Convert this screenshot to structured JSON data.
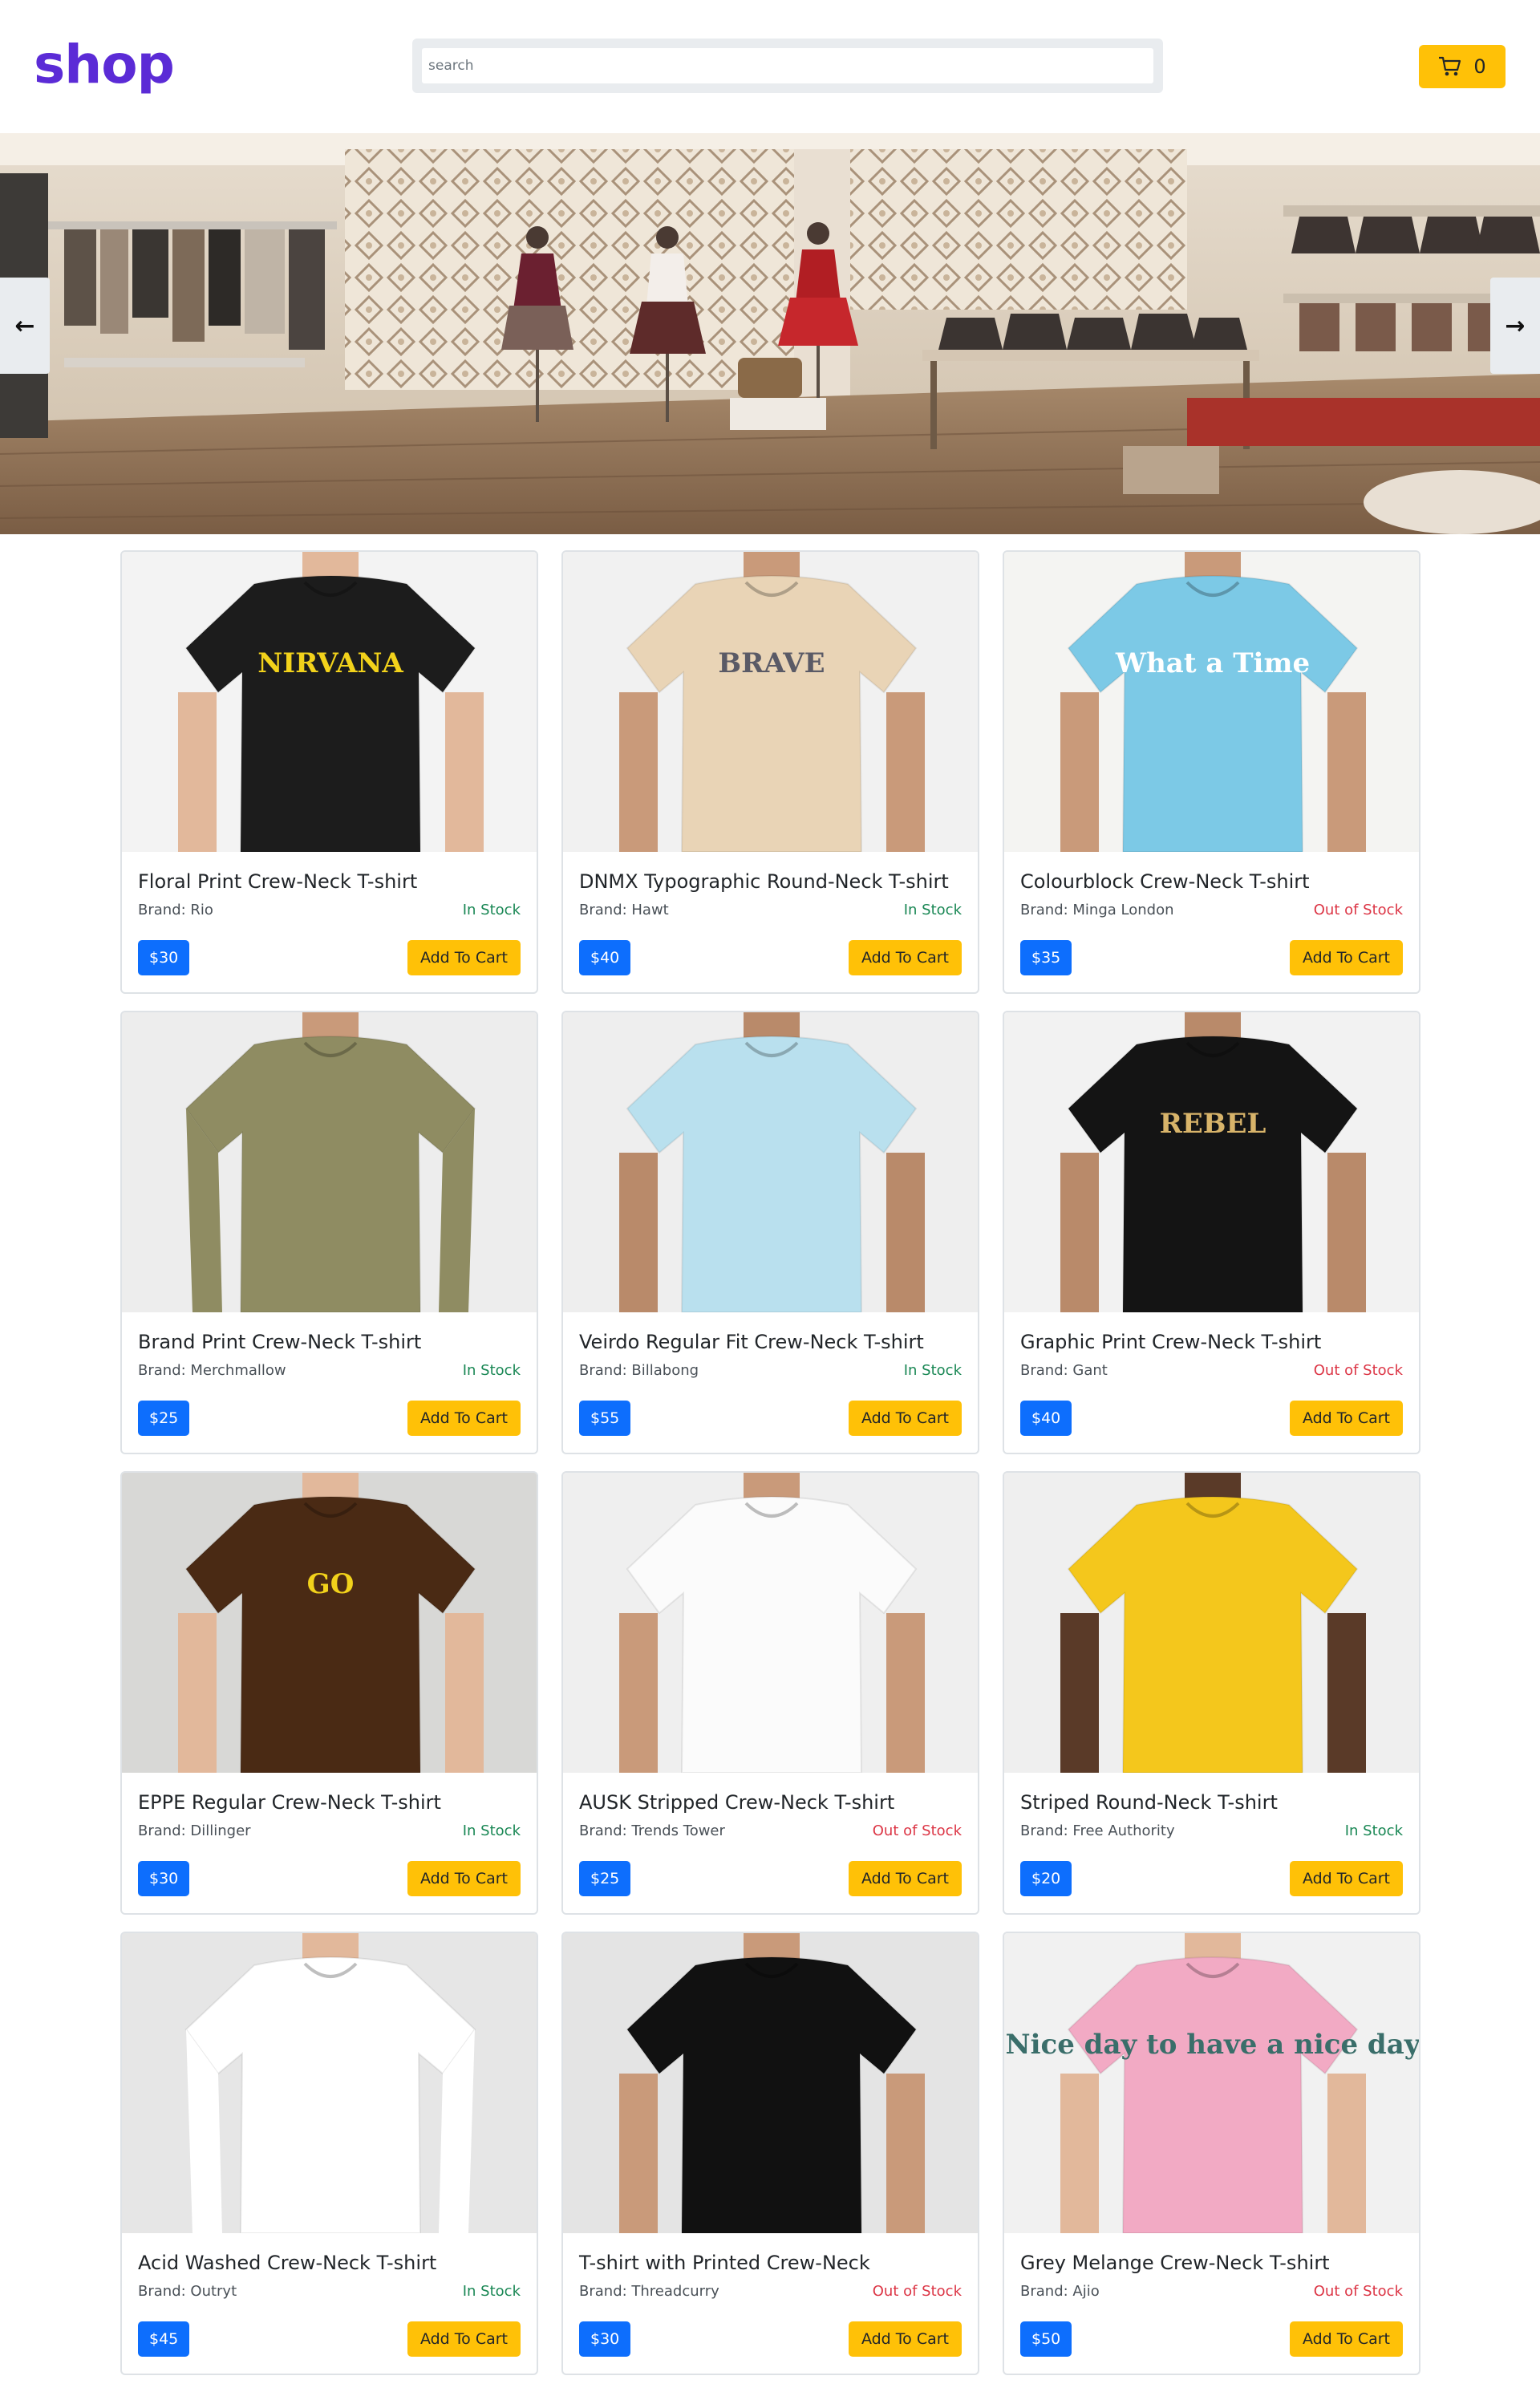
{
  "header": {
    "logo": "shop",
    "search_placeholder": "search",
    "cart_count": "0"
  },
  "carousel": {
    "prev_icon": "arrow-left-icon",
    "next_icon": "arrow-right-icon"
  },
  "products": [
    {
      "title": "Floral Print Crew-Neck T-shirt",
      "brand": "Brand: Rio",
      "stock": "In Stock",
      "in_stock": true,
      "price": "$30",
      "cta": "Add To Cart",
      "shirt": "#1c1c1c",
      "print": "NIRVANA",
      "print_color": "#f2d21b",
      "bg": "#f3f3f3",
      "skin": "#e2b89b"
    },
    {
      "title": "DNMX Typographic Round-Neck T-shirt",
      "brand": "Brand: Hawt",
      "stock": "In Stock",
      "in_stock": true,
      "price": "$40",
      "cta": "Add To Cart",
      "shirt": "#e9d4b6",
      "print": "BRAVE",
      "print_color": "#5a5a66",
      "bg": "#f1f1f1",
      "skin": "#c99a7a"
    },
    {
      "title": "Colourblock Crew-Neck T-shirt",
      "brand": "Brand: Minga London",
      "stock": "Out of Stock",
      "in_stock": false,
      "price": "$35",
      "cta": "Add To Cart",
      "shirt": "#7cc9e6",
      "print": "What a Time",
      "print_color": "#ffffff",
      "bg": "#f4f4f2",
      "skin": "#c99a7a"
    },
    {
      "title": "Brand Print Crew-Neck T-shirt",
      "brand": "Brand: Merchmallow",
      "stock": "In Stock",
      "in_stock": true,
      "price": "$25",
      "cta": "Add To Cart",
      "shirt": "#8f8c62",
      "print": "",
      "print_color": "#ffffff",
      "bg": "#ededed",
      "skin": "#c99a7a"
    },
    {
      "title": "Veirdo Regular Fit Crew-Neck T-shirt",
      "brand": "Brand: Billabong",
      "stock": "In Stock",
      "in_stock": true,
      "price": "$55",
      "cta": "Add To Cart",
      "shirt": "#b9e0ee",
      "print": "",
      "print_color": "#ffffff",
      "bg": "#eeeeee",
      "skin": "#b98a6a"
    },
    {
      "title": "Graphic Print Crew-Neck T-shirt",
      "brand": "Brand: Gant",
      "stock": "Out of Stock",
      "in_stock": false,
      "price": "$40",
      "cta": "Add To Cart",
      "shirt": "#141414",
      "print": "REBEL",
      "print_color": "#d8b46a",
      "bg": "#f2f2f2",
      "skin": "#b98a6a"
    },
    {
      "title": "EPPE Regular Crew-Neck T-shirt",
      "brand": "Brand: Dillinger",
      "stock": "In Stock",
      "in_stock": true,
      "price": "$30",
      "cta": "Add To Cart",
      "shirt": "#4a2a14",
      "print": "GO",
      "print_color": "#f2d21b",
      "bg": "#d8d8d6",
      "skin": "#e2b89b"
    },
    {
      "title": "AUSK Stripped Crew-Neck T-shirt",
      "brand": "Brand: Trends Tower",
      "stock": "Out of Stock",
      "in_stock": false,
      "price": "$25",
      "cta": "Add To Cart",
      "shirt": "#fbfbfb",
      "print": "",
      "print_color": "#ffffff",
      "bg": "#efefef",
      "skin": "#c99a7a"
    },
    {
      "title": "Striped Round-Neck T-shirt",
      "brand": "Brand: Free Authority",
      "stock": "In Stock",
      "in_stock": true,
      "price": "$20",
      "cta": "Add To Cart",
      "shirt": "#f4c71c",
      "print": "",
      "print_color": "#ffffff",
      "bg": "#efefef",
      "skin": "#5a3a28"
    },
    {
      "title": "Acid Washed Crew-Neck T-shirt",
      "brand": "Brand: Outryt",
      "stock": "In Stock",
      "in_stock": true,
      "price": "$45",
      "cta": "Add To Cart",
      "shirt": "#ffffff",
      "print": "",
      "print_color": "#777777",
      "bg": "#e6e6e6",
      "skin": "#e2b89b"
    },
    {
      "title": "T-shirt with Printed Crew-Neck",
      "brand": "Brand: Threadcurry",
      "stock": "Out of Stock",
      "in_stock": false,
      "price": "$30",
      "cta": "Add To Cart",
      "shirt": "#111111",
      "print": "",
      "print_color": "#8e1a23",
      "bg": "#e4e4e4",
      "skin": "#c99a7a"
    },
    {
      "title": "Grey Melange Crew-Neck T-shirt",
      "brand": "Brand: Ajio",
      "stock": "Out of Stock",
      "in_stock": false,
      "price": "$50",
      "cta": "Add To Cart",
      "shirt": "#f2aac4",
      "print": "Nice day to have a nice day",
      "print_color": "#3a6e6a",
      "bg": "#f1f1f1",
      "skin": "#e2b89b"
    }
  ]
}
